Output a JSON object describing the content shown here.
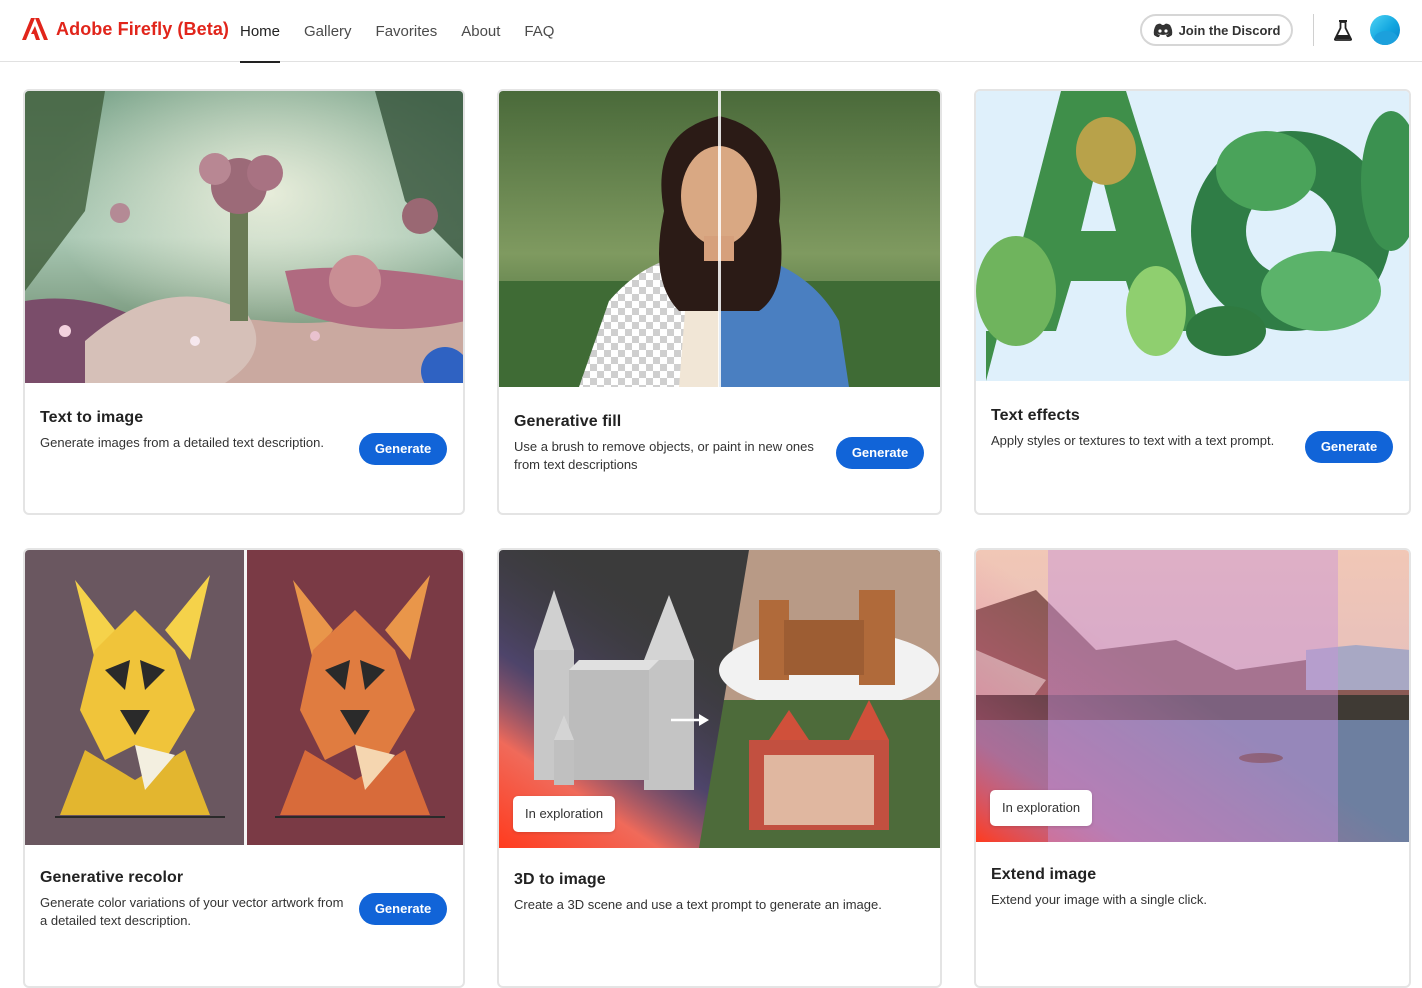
{
  "header": {
    "brand": "Adobe Firefly (Beta)",
    "nav": [
      {
        "label": "Home",
        "active": true
      },
      {
        "label": "Gallery",
        "active": false
      },
      {
        "label": "Favorites",
        "active": false
      },
      {
        "label": "About",
        "active": false
      },
      {
        "label": "FAQ",
        "active": false
      }
    ],
    "discord_label": "Join the Discord"
  },
  "colors": {
    "brand_red": "#e1251b",
    "accent_blue": "#1164d8"
  },
  "cards": [
    {
      "title": "Text to image",
      "description": "Generate images from a detailed text description.",
      "button": "Generate",
      "image": "fantasy-garden"
    },
    {
      "title": "Generative fill",
      "description": "Use a brush to remove objects, or paint in new ones from text descriptions",
      "button": "Generate",
      "image": "woman-portrait"
    },
    {
      "title": "Text effects",
      "description": "Apply styles or textures to text with a text prompt.",
      "button": "Generate",
      "image": "leafy-letters"
    },
    {
      "title": "Generative recolor",
      "description": "Generate color variations of your vector artwork from a detailed text description.",
      "button": "Generate",
      "image": "dog-vector"
    },
    {
      "title": "3D to image",
      "description": "Create a 3D scene and use a text prompt to generate an image.",
      "badge": "In exploration",
      "image": "castle-3d"
    },
    {
      "title": "Extend image",
      "description": "Extend your image with a single click.",
      "badge": "In exploration",
      "image": "lake-landscape"
    }
  ]
}
